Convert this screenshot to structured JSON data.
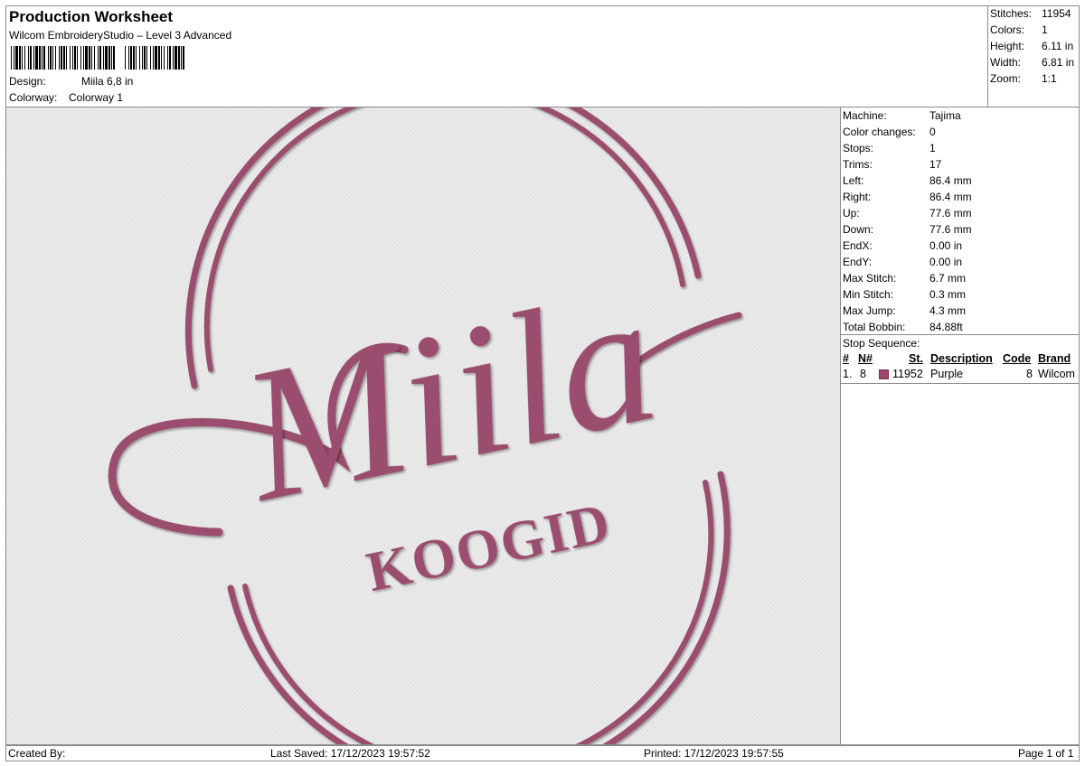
{
  "header": {
    "title": "Production Worksheet",
    "subtitle": "Wilcom EmbroideryStudio – Level 3 Advanced",
    "design_label": "Design:",
    "design_value": "Miila 6,8 in",
    "colorway_label": "Colorway:",
    "colorway_value": "Colorway 1"
  },
  "summary": {
    "stitches_label": "Stitches:",
    "stitches_value": "11954",
    "colors_label": "Colors:",
    "colors_value": "1",
    "height_label": "Height:",
    "height_value": "6.11 in",
    "width_label": "Width:",
    "width_value": "6.81 in",
    "zoom_label": "Zoom:",
    "zoom_value": "1:1"
  },
  "machine": [
    {
      "k": "Machine:",
      "v": "Tajima"
    },
    {
      "k": "Color changes:",
      "v": "0"
    },
    {
      "k": "Stops:",
      "v": "1"
    },
    {
      "k": "Trims:",
      "v": "17"
    },
    {
      "k": "Left:",
      "v": "86.4 mm"
    },
    {
      "k": "Right:",
      "v": "86.4 mm"
    },
    {
      "k": "Up:",
      "v": "77.6 mm"
    },
    {
      "k": "Down:",
      "v": "77.6 mm"
    },
    {
      "k": "EndX:",
      "v": "0.00 in"
    },
    {
      "k": "EndY:",
      "v": "0.00 in"
    },
    {
      "k": "Max Stitch:",
      "v": "6.7 mm"
    },
    {
      "k": "Min Stitch:",
      "v": "0.3 mm"
    },
    {
      "k": "Max Jump:",
      "v": "4.3 mm"
    },
    {
      "k": "Total Bobbin:",
      "v": "84.88ft"
    }
  ],
  "stop_sequence": {
    "title": "Stop Sequence:",
    "headers": {
      "num": "#",
      "needle": "N#",
      "stitches": "St.",
      "description": "Description",
      "code": "Code",
      "brand": "Brand"
    },
    "rows": [
      {
        "num": "1.",
        "needle": "8",
        "stitches": "11952",
        "description": "Purple",
        "code": "8",
        "brand": "Wilcom",
        "color": "#a0456e"
      }
    ]
  },
  "design": {
    "main_text": "Miila",
    "sub_text": "KOOGID",
    "thread_color": "#9a4e6e"
  },
  "footer": {
    "created_by": "Created By:",
    "last_saved": "Last Saved: 17/12/2023 19:57:52",
    "printed": "Printed: 17/12/2023 19:57:55",
    "page": "Page 1 of 1"
  }
}
